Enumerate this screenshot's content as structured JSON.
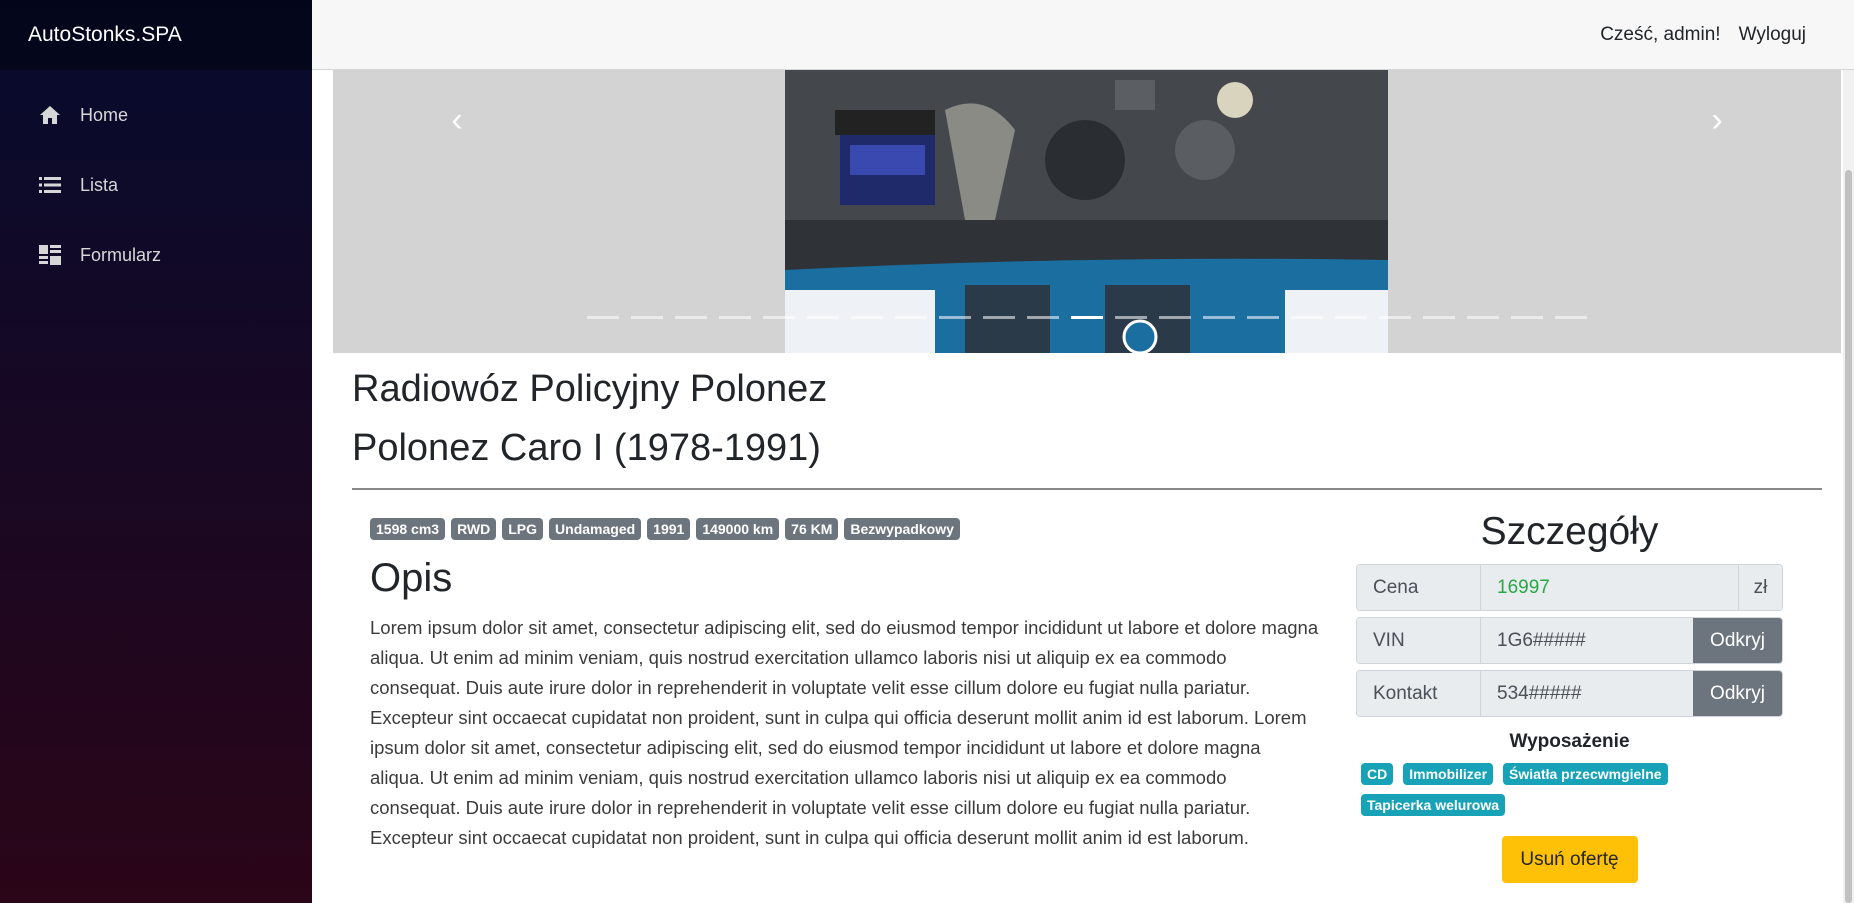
{
  "app": {
    "brand": "AutoStonks.SPA"
  },
  "sidebar": {
    "items": [
      {
        "label": "Home",
        "icon": "home-icon"
      },
      {
        "label": "Lista",
        "icon": "list-icon"
      },
      {
        "label": "Formularz",
        "icon": "form-icon"
      }
    ]
  },
  "header": {
    "greeting": "Cześć, admin!",
    "logout": "Wyloguj"
  },
  "carousel": {
    "prev_icon": "chevron-left-icon",
    "next_icon": "chevron-right-icon"
  },
  "listing": {
    "title_line1": "Radiowóz Policyjny Polonez",
    "title_line2": "Polonez Caro I (1978-1991)",
    "badges": [
      "1598 cm3",
      "RWD",
      "LPG",
      "Undamaged",
      "1991",
      "149000 km",
      "76 KM",
      "Bezwypadkowy"
    ],
    "opis_heading": "Opis",
    "opis_text": "Lorem ipsum dolor sit amet, consectetur adipiscing elit, sed do eiusmod tempor incididunt ut labore et dolore magna aliqua. Ut enim ad minim veniam, quis nostrud exercitation ullamco laboris nisi ut aliquip ex ea commodo consequat. Duis aute irure dolor in reprehenderit in voluptate velit esse cillum dolore eu fugiat nulla pariatur. Excepteur sint occaecat cupidatat non proident, sunt in culpa qui officia deserunt mollit anim id est laborum. Lorem ipsum dolor sit amet, consectetur adipiscing elit, sed do eiusmod tempor incididunt ut labore et dolore magna aliqua. Ut enim ad minim veniam, quis nostrud exercitation ullamco laboris nisi ut aliquip ex ea commodo consequat. Duis aute irure dolor in reprehenderit in voluptate velit esse cillum dolore eu fugiat nulla pariatur. Excepteur sint occaecat cupidatat non proident, sunt in culpa qui officia deserunt mollit anim id est laborum."
  },
  "details": {
    "heading": "Szczegóły",
    "price_label": "Cena",
    "price_value": "16997",
    "price_suffix": "zł",
    "vin_label": "VIN",
    "vin_value": "1G6#####",
    "vin_button": "Odkryj",
    "contact_label": "Kontakt",
    "contact_value": "534#####",
    "contact_button": "Odkryj",
    "equipment_heading": "Wyposażenie",
    "equipment": [
      "CD",
      "Immobilizer",
      "Światła przecwmgielne",
      "Tapicerka welurowa"
    ],
    "delete_button": "Usuń ofertę"
  },
  "colors": {
    "sidebar_top": "#060b2e",
    "sidebar_bottom": "#2b0518",
    "badge_secondary": "#6c757d",
    "badge_info": "#17a2b8",
    "price_green": "#28a745",
    "warning": "#ffc107"
  }
}
